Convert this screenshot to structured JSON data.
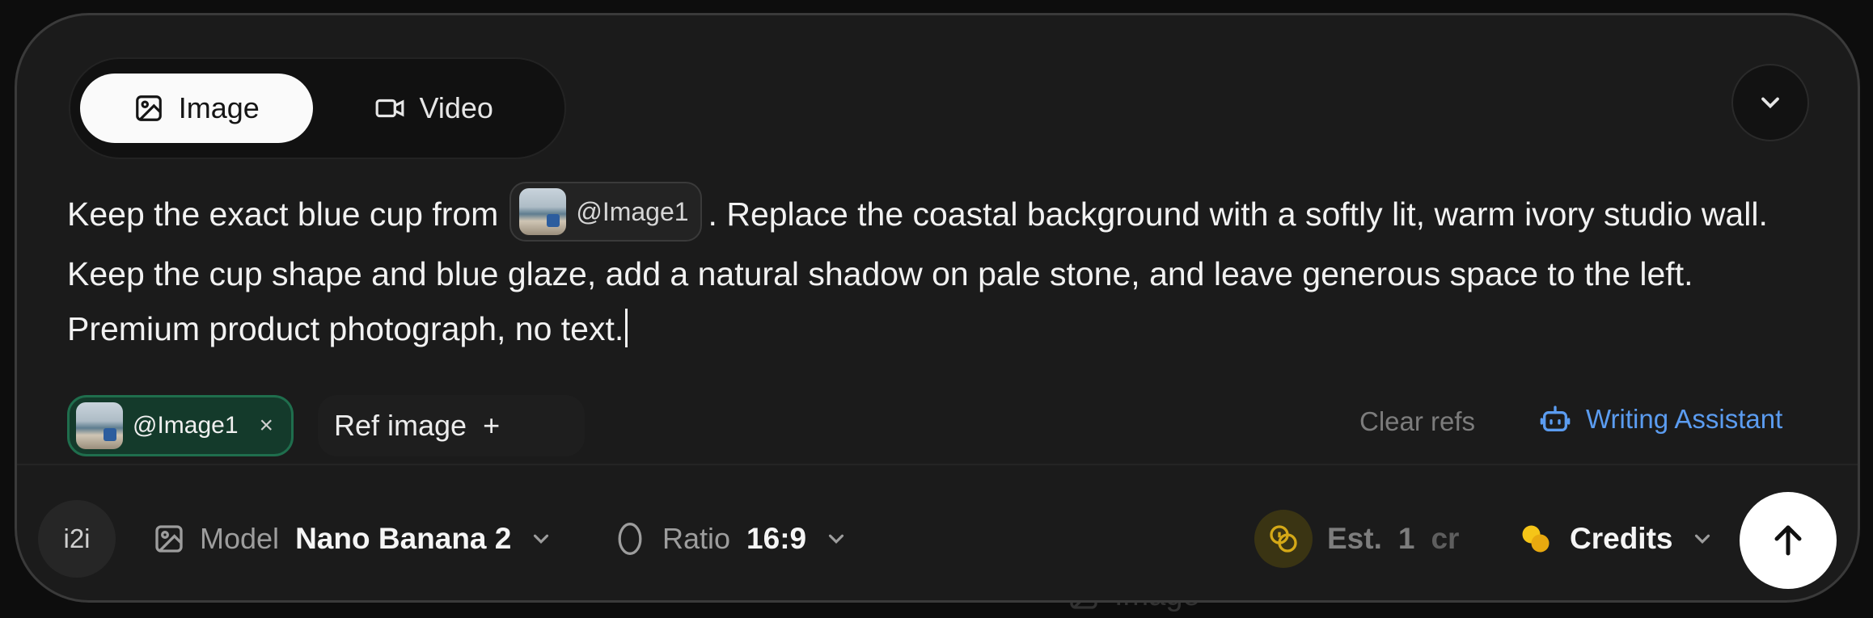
{
  "tabs": [
    {
      "label": "Image",
      "icon": "image-icon",
      "active": true
    },
    {
      "label": "Video",
      "icon": "video-icon",
      "active": false
    }
  ],
  "prompt": {
    "before": "Keep the exact blue cup from",
    "mention": "@Image1",
    "after": ". Replace the coastal background with a softly lit, warm ivory studio wall. Keep the cup shape and blue glaze, add a natural shadow on pale stone, and leave generous space to the left. Premium product photograph, no text."
  },
  "refs": {
    "chip_label": "@Image1",
    "add_label": "Ref image",
    "add_symbol": "+",
    "remove_symbol": "×",
    "clear_label": "Clear refs",
    "assistant_label": "Writing Assistant"
  },
  "toolbar": {
    "mode": "i2i",
    "model_label": "Model",
    "model_value": "Nano Banana 2",
    "ratio_label": "Ratio",
    "ratio_value": "16:9",
    "est_label": "Est.",
    "est_value": "1",
    "est_unit": "cr",
    "credits_label": "Credits"
  },
  "under_hint": "Image",
  "colors": {
    "accent_blue": "#5b9cf0",
    "ref_chip_bg": "#143a2b",
    "ref_chip_border": "#1f6e4d",
    "credit_yellow": "#f5c518"
  }
}
